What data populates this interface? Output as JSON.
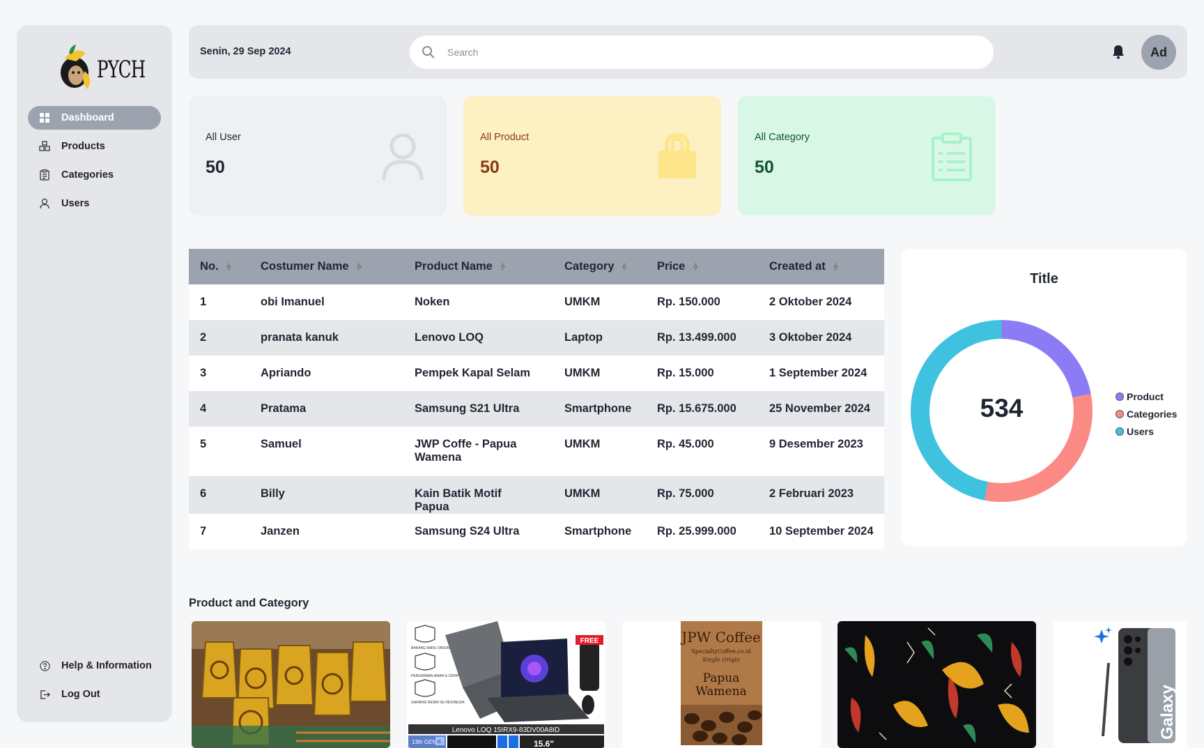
{
  "brand": {
    "name": "PYCH"
  },
  "sidebar": {
    "items": [
      {
        "label": "Dashboard",
        "icon": "grid-icon",
        "active": true
      },
      {
        "label": "Products",
        "icon": "boxes-icon"
      },
      {
        "label": "Categories",
        "icon": "clipboard-icon"
      },
      {
        "label": "Users",
        "icon": "user-icon"
      }
    ],
    "bottom": [
      {
        "label": "Help & Information",
        "icon": "help-circle-icon"
      },
      {
        "label": "Log Out",
        "icon": "logout-icon"
      }
    ]
  },
  "header": {
    "date": "Senin, 29 Sep 2024",
    "search_placeholder": "Search",
    "avatar_initials": "Ad"
  },
  "stats": [
    {
      "label": "All User",
      "value": "50",
      "bg": "#eef0f3",
      "color": "#1f2430",
      "icon": "user-outline-icon"
    },
    {
      "label": "All Product",
      "value": "50",
      "bg": "#fdf0c2",
      "color": "#8a3a12",
      "icon": "shopping-bag-icon"
    },
    {
      "label": "All Category",
      "value": "50",
      "bg": "#d9f7e6",
      "color": "#14532d",
      "icon": "clipboard-list-icon"
    }
  ],
  "table": {
    "columns": [
      "No.",
      "Costumer Name",
      "Product Name",
      "Category",
      "Price",
      "Created at"
    ],
    "rows": [
      [
        "1",
        "obi Imanuel",
        "Noken",
        "UMKM",
        "Rp. 150.000",
        "2 Oktober 2024"
      ],
      [
        "2",
        "pranata kanuk",
        "Lenovo LOQ",
        "Laptop",
        "Rp. 13.499.000",
        "3 Oktober 2024"
      ],
      [
        "3",
        "Apriando",
        "Pempek Kapal Selam",
        "UMKM",
        "Rp. 15.000",
        "1 September 2024"
      ],
      [
        "4",
        "Pratama",
        "Samsung S21 Ultra",
        "Smartphone",
        "Rp. 15.675.000",
        "25 November 2024"
      ],
      [
        "5",
        "Samuel",
        "JWP Coffe - Papua Wamena",
        "UMKM",
        "Rp. 45.000",
        "9 Desember 2023"
      ],
      [
        "6",
        "Billy",
        "Kain Batik Motif Papua",
        "UMKM",
        "Rp. 75.000",
        "2 Februari 2023"
      ],
      [
        "7",
        "Janzen",
        "Samsung S24 Ultra",
        "Smartphone",
        "Rp. 25.999.000",
        "10 September 2024"
      ]
    ]
  },
  "chart_data": {
    "type": "pie",
    "title": "Title",
    "center_label": "534",
    "legend_position": "right",
    "categories": [
      "Product",
      "Categories",
      "Users"
    ],
    "values": [
      22,
      31,
      47
    ],
    "colors": [
      "#8b7cf6",
      "#fb8a84",
      "#3fc2e0"
    ]
  },
  "gallery": {
    "title": "Product and Category",
    "items": [
      {
        "name": "Noken"
      },
      {
        "name": "Lenovo LOQ",
        "badge": "FREE",
        "caption": "Lenovo LOQ 15IRX9-83DV00A8ID",
        "tags": [
          "13th GEN",
          "i5"
        ],
        "size_text": "15.6\"",
        "features": [
          "BARANG BARU ORIGINAL",
          "PENGIRIMAN AMAN & CEPAT",
          "GARANSI RESMI SE INDONESIA"
        ]
      },
      {
        "name": "JPW Coffee",
        "brand": "JPW Coffee",
        "subtitle": "SpecialtyCoffee.co.id",
        "tagline": "Single Origin",
        "origin_line1": "Papua",
        "origin_line2": "Wamena"
      },
      {
        "name": "Kain Batik Motif Papua"
      },
      {
        "name": "Samsung Galaxy",
        "brand_text": "Galaxy"
      }
    ]
  }
}
